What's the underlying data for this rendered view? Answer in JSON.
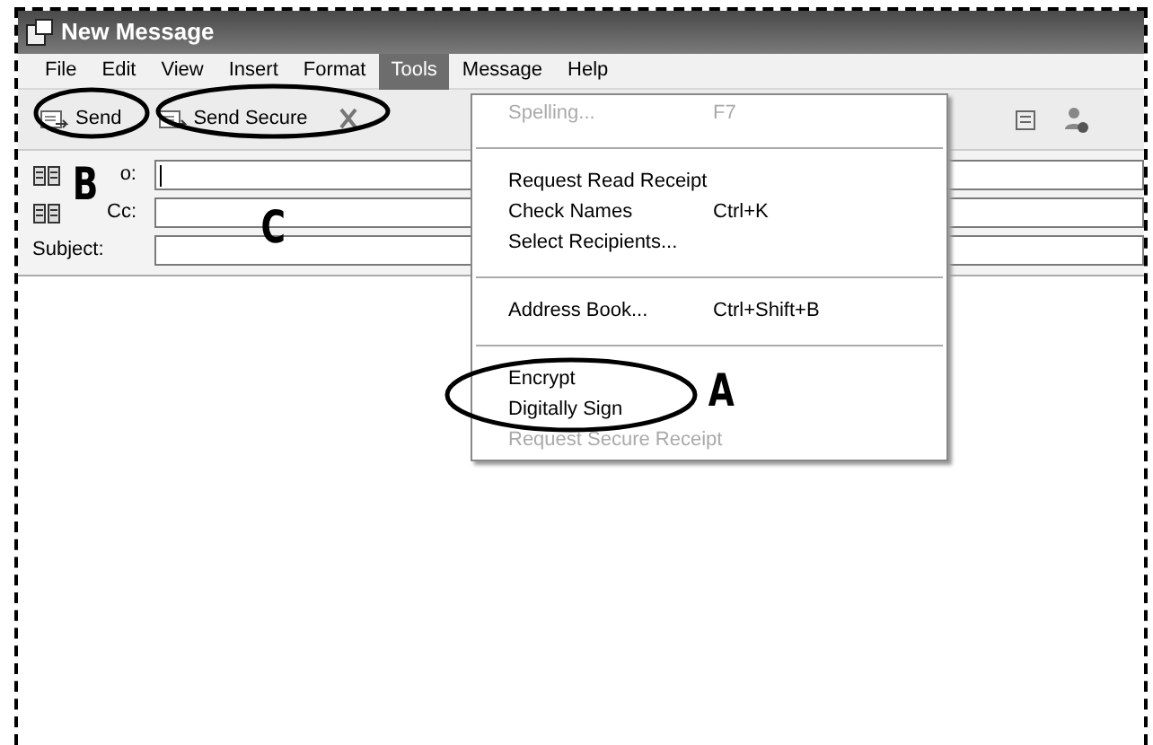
{
  "window": {
    "title": "New Message"
  },
  "menu_bar": [
    {
      "label": "File",
      "selected": false
    },
    {
      "label": "Edit",
      "selected": false
    },
    {
      "label": "View",
      "selected": false
    },
    {
      "label": "Insert",
      "selected": false
    },
    {
      "label": "Format",
      "selected": false
    },
    {
      "label": "Tools",
      "selected": true
    },
    {
      "label": "Message",
      "selected": false
    },
    {
      "label": "Help",
      "selected": false
    }
  ],
  "toolbar": {
    "buttons": [
      {
        "label": "Send"
      },
      {
        "label": "Send Secure"
      }
    ]
  },
  "fields": [
    {
      "label": "o:",
      "address_book": true,
      "focused": true
    },
    {
      "label": "Cc:",
      "address_book": true,
      "focused": false
    },
    {
      "label": "Subject:",
      "address_book": false,
      "focused": false
    }
  ],
  "tools_menu": [
    {
      "kind": "item",
      "label": "Spelling...",
      "shortcut": "F7",
      "disabled": true
    },
    {
      "kind": "separator"
    },
    {
      "kind": "item",
      "label": "Request Read Receipt",
      "disabled": false
    },
    {
      "kind": "item",
      "label": "Check Names",
      "shortcut": "Ctrl+K",
      "disabled": false
    },
    {
      "kind": "item",
      "label": "Select Recipients...",
      "disabled": false
    },
    {
      "kind": "separator"
    },
    {
      "kind": "item",
      "label": "Address Book...",
      "shortcut": "Ctrl+Shift+B",
      "disabled": false
    },
    {
      "kind": "separator"
    },
    {
      "kind": "item",
      "label": "Encrypt",
      "disabled": false
    },
    {
      "kind": "item",
      "label": "Digitally Sign",
      "disabled": false
    },
    {
      "kind": "item",
      "label": "Request Secure Receipt",
      "disabled": true
    }
  ],
  "annotations": [
    {
      "letter": "B"
    },
    {
      "letter": "C"
    },
    {
      "letter": "A"
    }
  ]
}
